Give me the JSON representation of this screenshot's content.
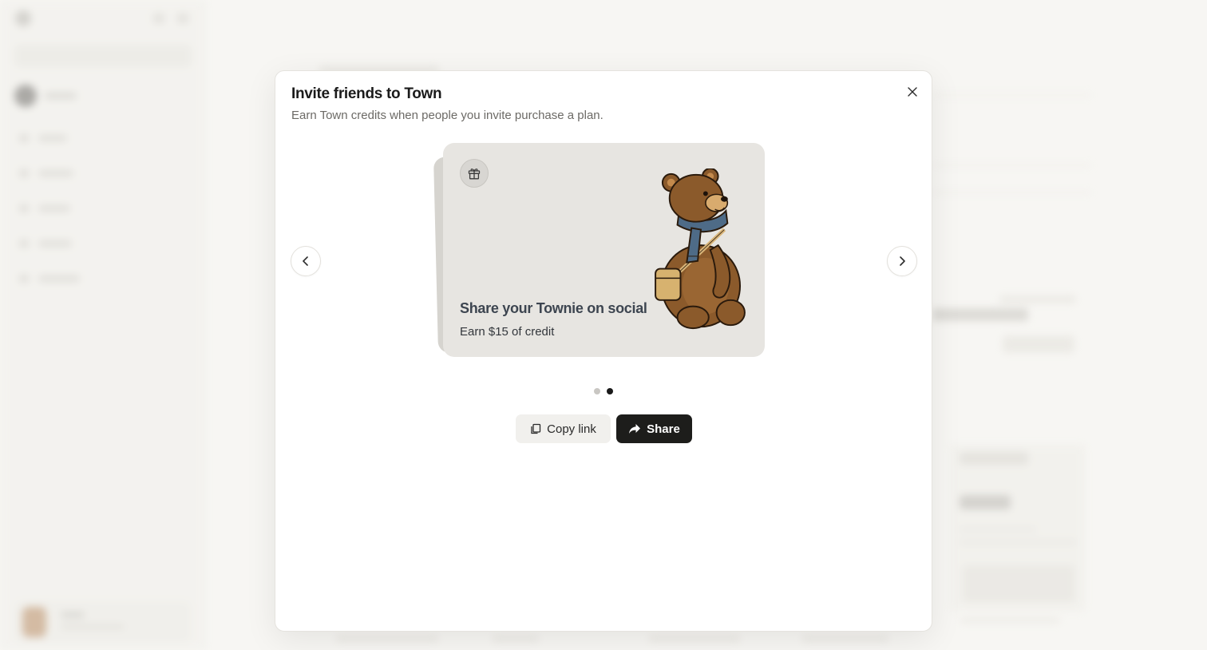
{
  "modal": {
    "title": "Invite friends to Town",
    "subtitle": "Earn Town credits when people you invite purchase a plan.",
    "close_icon": "close-icon",
    "prev_icon": "chevron-left-icon",
    "next_icon": "chevron-right-icon"
  },
  "card": {
    "badge_icon": "gift-icon",
    "title": "Share your Townie on social",
    "subtitle": "Earn $15 of credit",
    "illustration": "bear-with-scarf-and-satchel"
  },
  "pagination": {
    "total": 2,
    "active": 2
  },
  "actions": {
    "copy_label": "Copy link",
    "copy_icon": "copy-icon",
    "share_label": "Share",
    "share_icon": "share-arrow-icon"
  },
  "colors": {
    "primary_button": "#1d1d1b",
    "card_background": "#e7e5e1",
    "card_title": "#3d4550",
    "bear_fur": "#8b5a2b",
    "scarf": "#4e6b87"
  }
}
